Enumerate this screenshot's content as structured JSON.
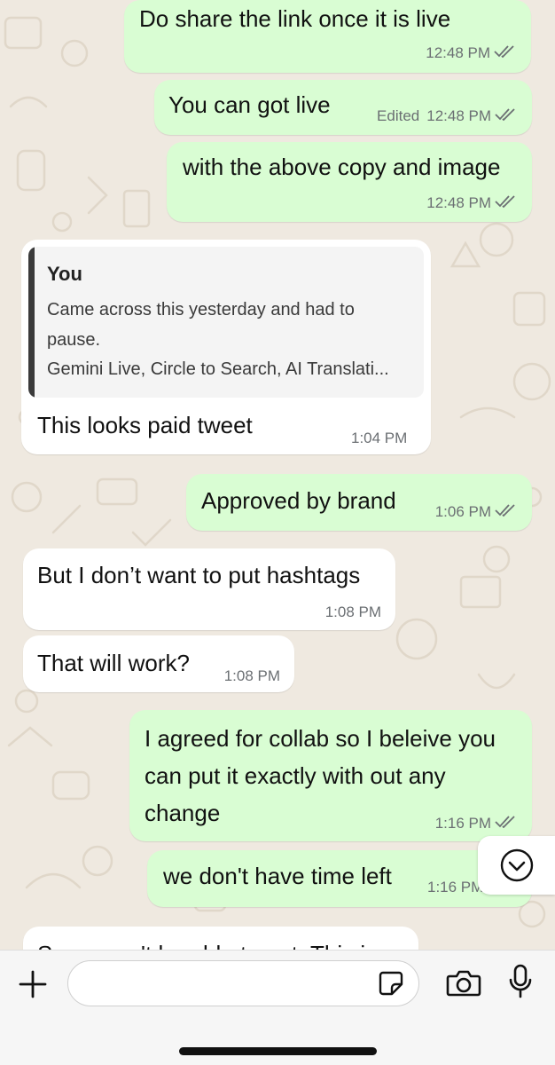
{
  "messages": [
    {
      "text": "Do share the link once it is live",
      "time": "12:48 PM",
      "direction": "outgoing",
      "status_icon": "double-check"
    },
    {
      "text": "You can got live",
      "edited": "Edited",
      "time": "12:48 PM",
      "direction": "outgoing",
      "status_icon": "double-check"
    },
    {
      "text": "with the above copy and image",
      "time": "12:48 PM",
      "direction": "outgoing",
      "status_icon": "double-check"
    },
    {
      "quote": {
        "author": "You",
        "lines": [
          "Came across this yesterday and had to",
          "pause.",
          "Gemini Live, Circle to Search, AI Translati..."
        ]
      },
      "text": "This looks paid tweet",
      "time": "1:04 PM",
      "direction": "incoming"
    },
    {
      "text": "Approved by brand",
      "time": "1:06 PM",
      "direction": "outgoing",
      "status_icon": "double-check"
    },
    {
      "text": "But I don’t want to put hashtags",
      "time": "1:08 PM",
      "direction": "incoming"
    },
    {
      "text": "That will work?",
      "time": "1:08 PM",
      "direction": "incoming"
    },
    {
      "lines": [
        "I agreed for collab so I beleive you",
        "can put it exactly with out any",
        "change"
      ],
      "time": "1:16 PM",
      "direction": "outgoing",
      "status_icon": "double-check"
    },
    {
      "text": "we don't have time left",
      "time": "1:16 PM",
      "direction": "outgoing",
      "status_icon": "double-check"
    },
    {
      "text": "Sorry won't be able to put. This is",
      "direction": "incoming",
      "partially_visible": true
    }
  ],
  "scroll_button": {
    "icon": "chevron-down-circle-icon"
  },
  "input_bar": {
    "attach_icon": "plus-icon",
    "placeholder": "",
    "sticker_icon": "sticker-icon",
    "camera_icon": "camera-icon",
    "mic_icon": "microphone-icon"
  },
  "colors": {
    "outgoing_bubble": "#d9fdd3",
    "incoming_bubble": "#ffffff",
    "chat_background": "#efe9e0",
    "read_ticks": "#6b6f73"
  }
}
